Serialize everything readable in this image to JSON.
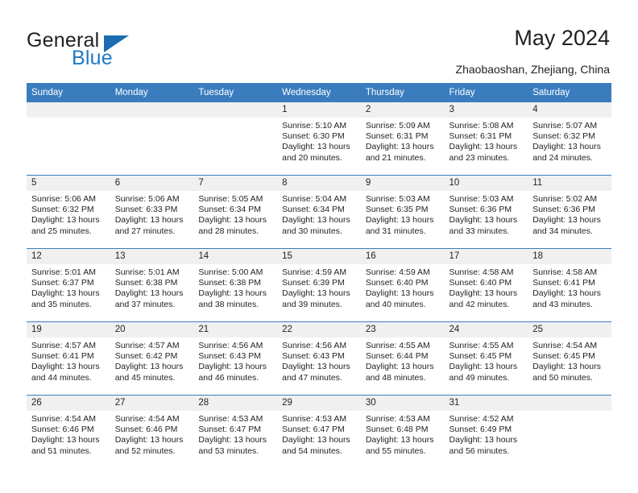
{
  "brand": {
    "word_one": "General",
    "word_two": "Blue",
    "triangle_icon": "triangle-icon",
    "accent_color": "#1b6cb0",
    "blue_text_color": "#1f7ac4"
  },
  "header": {
    "title": "May 2024",
    "location": "Zhaobaoshan, Zhejiang, China"
  },
  "theme": {
    "header_row_bg": "#3a7dbf",
    "daynum_bg": "#f0f0f0",
    "row_divider": "#3a7dbf",
    "text": "#231f20"
  },
  "weekday_headers": [
    "Sunday",
    "Monday",
    "Tuesday",
    "Wednesday",
    "Thursday",
    "Friday",
    "Saturday"
  ],
  "weeks": [
    [
      {
        "day": "",
        "sunrise": "",
        "sunset": "",
        "daylight_line1": "",
        "daylight_line2": ""
      },
      {
        "day": "",
        "sunrise": "",
        "sunset": "",
        "daylight_line1": "",
        "daylight_line2": ""
      },
      {
        "day": "",
        "sunrise": "",
        "sunset": "",
        "daylight_line1": "",
        "daylight_line2": ""
      },
      {
        "day": "1",
        "sunrise": "Sunrise: 5:10 AM",
        "sunset": "Sunset: 6:30 PM",
        "daylight_line1": "Daylight: 13 hours",
        "daylight_line2": "and 20 minutes."
      },
      {
        "day": "2",
        "sunrise": "Sunrise: 5:09 AM",
        "sunset": "Sunset: 6:31 PM",
        "daylight_line1": "Daylight: 13 hours",
        "daylight_line2": "and 21 minutes."
      },
      {
        "day": "3",
        "sunrise": "Sunrise: 5:08 AM",
        "sunset": "Sunset: 6:31 PM",
        "daylight_line1": "Daylight: 13 hours",
        "daylight_line2": "and 23 minutes."
      },
      {
        "day": "4",
        "sunrise": "Sunrise: 5:07 AM",
        "sunset": "Sunset: 6:32 PM",
        "daylight_line1": "Daylight: 13 hours",
        "daylight_line2": "and 24 minutes."
      }
    ],
    [
      {
        "day": "5",
        "sunrise": "Sunrise: 5:06 AM",
        "sunset": "Sunset: 6:32 PM",
        "daylight_line1": "Daylight: 13 hours",
        "daylight_line2": "and 25 minutes."
      },
      {
        "day": "6",
        "sunrise": "Sunrise: 5:06 AM",
        "sunset": "Sunset: 6:33 PM",
        "daylight_line1": "Daylight: 13 hours",
        "daylight_line2": "and 27 minutes."
      },
      {
        "day": "7",
        "sunrise": "Sunrise: 5:05 AM",
        "sunset": "Sunset: 6:34 PM",
        "daylight_line1": "Daylight: 13 hours",
        "daylight_line2": "and 28 minutes."
      },
      {
        "day": "8",
        "sunrise": "Sunrise: 5:04 AM",
        "sunset": "Sunset: 6:34 PM",
        "daylight_line1": "Daylight: 13 hours",
        "daylight_line2": "and 30 minutes."
      },
      {
        "day": "9",
        "sunrise": "Sunrise: 5:03 AM",
        "sunset": "Sunset: 6:35 PM",
        "daylight_line1": "Daylight: 13 hours",
        "daylight_line2": "and 31 minutes."
      },
      {
        "day": "10",
        "sunrise": "Sunrise: 5:03 AM",
        "sunset": "Sunset: 6:36 PM",
        "daylight_line1": "Daylight: 13 hours",
        "daylight_line2": "and 33 minutes."
      },
      {
        "day": "11",
        "sunrise": "Sunrise: 5:02 AM",
        "sunset": "Sunset: 6:36 PM",
        "daylight_line1": "Daylight: 13 hours",
        "daylight_line2": "and 34 minutes."
      }
    ],
    [
      {
        "day": "12",
        "sunrise": "Sunrise: 5:01 AM",
        "sunset": "Sunset: 6:37 PM",
        "daylight_line1": "Daylight: 13 hours",
        "daylight_line2": "and 35 minutes."
      },
      {
        "day": "13",
        "sunrise": "Sunrise: 5:01 AM",
        "sunset": "Sunset: 6:38 PM",
        "daylight_line1": "Daylight: 13 hours",
        "daylight_line2": "and 37 minutes."
      },
      {
        "day": "14",
        "sunrise": "Sunrise: 5:00 AM",
        "sunset": "Sunset: 6:38 PM",
        "daylight_line1": "Daylight: 13 hours",
        "daylight_line2": "and 38 minutes."
      },
      {
        "day": "15",
        "sunrise": "Sunrise: 4:59 AM",
        "sunset": "Sunset: 6:39 PM",
        "daylight_line1": "Daylight: 13 hours",
        "daylight_line2": "and 39 minutes."
      },
      {
        "day": "16",
        "sunrise": "Sunrise: 4:59 AM",
        "sunset": "Sunset: 6:40 PM",
        "daylight_line1": "Daylight: 13 hours",
        "daylight_line2": "and 40 minutes."
      },
      {
        "day": "17",
        "sunrise": "Sunrise: 4:58 AM",
        "sunset": "Sunset: 6:40 PM",
        "daylight_line1": "Daylight: 13 hours",
        "daylight_line2": "and 42 minutes."
      },
      {
        "day": "18",
        "sunrise": "Sunrise: 4:58 AM",
        "sunset": "Sunset: 6:41 PM",
        "daylight_line1": "Daylight: 13 hours",
        "daylight_line2": "and 43 minutes."
      }
    ],
    [
      {
        "day": "19",
        "sunrise": "Sunrise: 4:57 AM",
        "sunset": "Sunset: 6:41 PM",
        "daylight_line1": "Daylight: 13 hours",
        "daylight_line2": "and 44 minutes."
      },
      {
        "day": "20",
        "sunrise": "Sunrise: 4:57 AM",
        "sunset": "Sunset: 6:42 PM",
        "daylight_line1": "Daylight: 13 hours",
        "daylight_line2": "and 45 minutes."
      },
      {
        "day": "21",
        "sunrise": "Sunrise: 4:56 AM",
        "sunset": "Sunset: 6:43 PM",
        "daylight_line1": "Daylight: 13 hours",
        "daylight_line2": "and 46 minutes."
      },
      {
        "day": "22",
        "sunrise": "Sunrise: 4:56 AM",
        "sunset": "Sunset: 6:43 PM",
        "daylight_line1": "Daylight: 13 hours",
        "daylight_line2": "and 47 minutes."
      },
      {
        "day": "23",
        "sunrise": "Sunrise: 4:55 AM",
        "sunset": "Sunset: 6:44 PM",
        "daylight_line1": "Daylight: 13 hours",
        "daylight_line2": "and 48 minutes."
      },
      {
        "day": "24",
        "sunrise": "Sunrise: 4:55 AM",
        "sunset": "Sunset: 6:45 PM",
        "daylight_line1": "Daylight: 13 hours",
        "daylight_line2": "and 49 minutes."
      },
      {
        "day": "25",
        "sunrise": "Sunrise: 4:54 AM",
        "sunset": "Sunset: 6:45 PM",
        "daylight_line1": "Daylight: 13 hours",
        "daylight_line2": "and 50 minutes."
      }
    ],
    [
      {
        "day": "26",
        "sunrise": "Sunrise: 4:54 AM",
        "sunset": "Sunset: 6:46 PM",
        "daylight_line1": "Daylight: 13 hours",
        "daylight_line2": "and 51 minutes."
      },
      {
        "day": "27",
        "sunrise": "Sunrise: 4:54 AM",
        "sunset": "Sunset: 6:46 PM",
        "daylight_line1": "Daylight: 13 hours",
        "daylight_line2": "and 52 minutes."
      },
      {
        "day": "28",
        "sunrise": "Sunrise: 4:53 AM",
        "sunset": "Sunset: 6:47 PM",
        "daylight_line1": "Daylight: 13 hours",
        "daylight_line2": "and 53 minutes."
      },
      {
        "day": "29",
        "sunrise": "Sunrise: 4:53 AM",
        "sunset": "Sunset: 6:47 PM",
        "daylight_line1": "Daylight: 13 hours",
        "daylight_line2": "and 54 minutes."
      },
      {
        "day": "30",
        "sunrise": "Sunrise: 4:53 AM",
        "sunset": "Sunset: 6:48 PM",
        "daylight_line1": "Daylight: 13 hours",
        "daylight_line2": "and 55 minutes."
      },
      {
        "day": "31",
        "sunrise": "Sunrise: 4:52 AM",
        "sunset": "Sunset: 6:49 PM",
        "daylight_line1": "Daylight: 13 hours",
        "daylight_line2": "and 56 minutes."
      },
      {
        "day": "",
        "sunrise": "",
        "sunset": "",
        "daylight_line1": "",
        "daylight_line2": ""
      }
    ]
  ]
}
